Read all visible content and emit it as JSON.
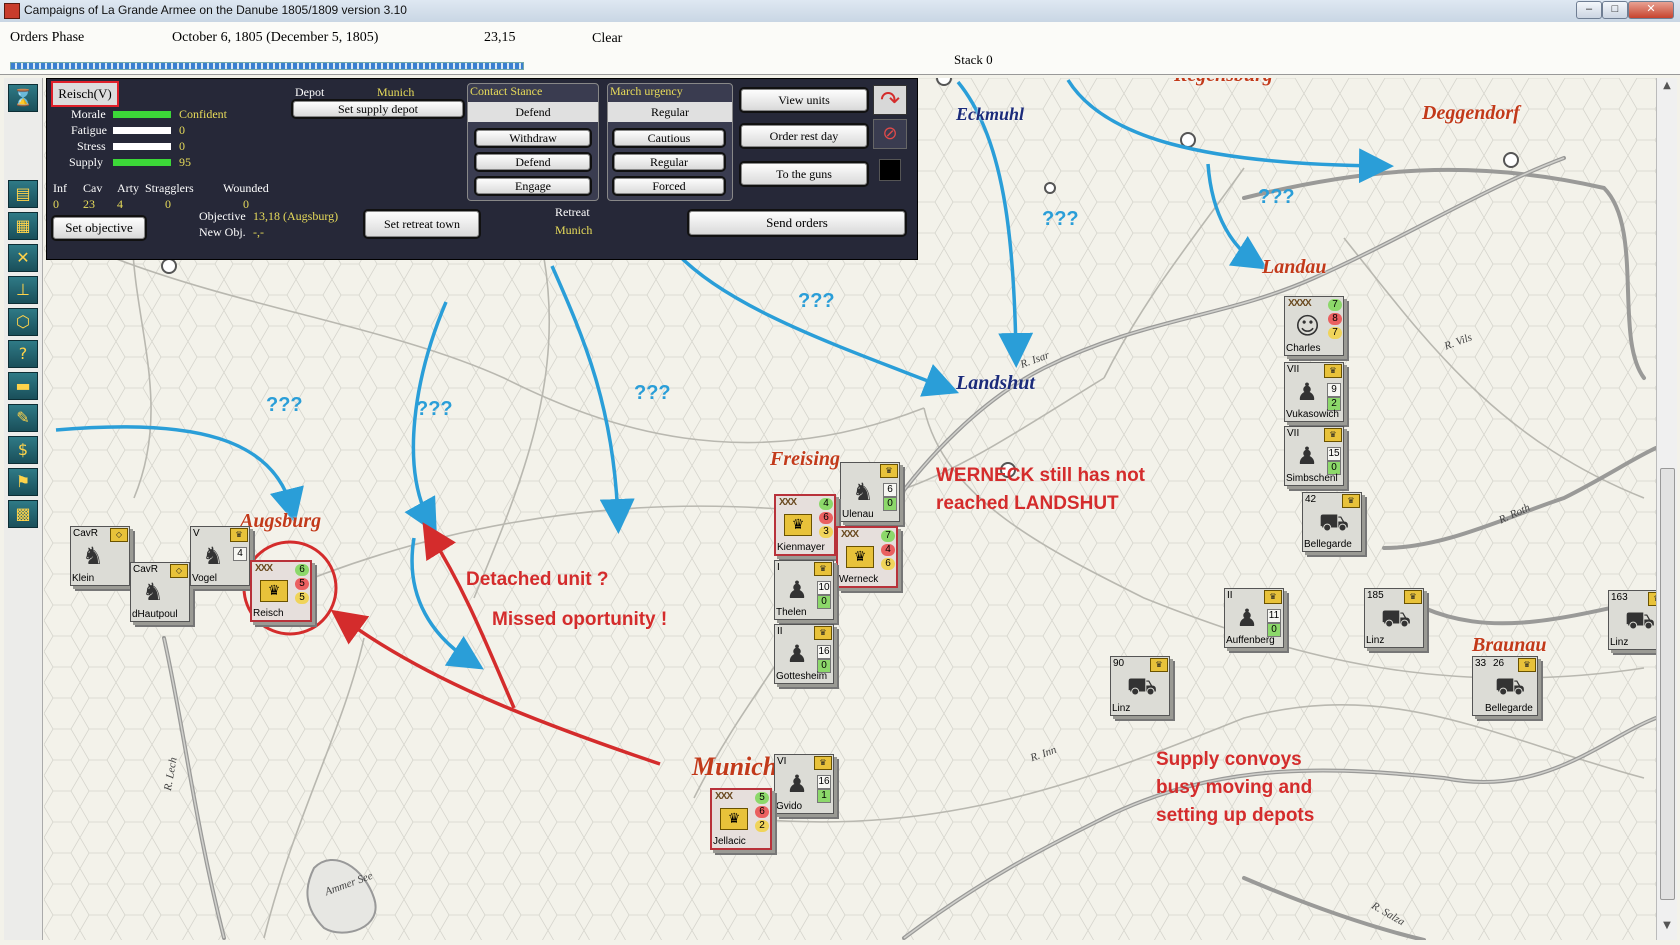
{
  "window": {
    "title": "Campaigns of La Grande Armee on the Danube 1805/1809 version 3.10",
    "min": "–",
    "max": "□",
    "close": "✕"
  },
  "topbar": {
    "phase": "Orders Phase",
    "date": "October 6, 1805 (December 5, 1805)",
    "coords": "23,15",
    "clear": "Clear",
    "stack": "Stack 0"
  },
  "toolbar_icons": [
    "hourglass-icon",
    "scroll-icon",
    "stack-icon",
    "crossed-swords-icon",
    "hierarchy-icon",
    "hexagon-icon",
    "question-icon",
    "ledger-icon",
    "pencil-icon",
    "dollar-icon",
    "flag-icon",
    "grid-icon"
  ],
  "panel": {
    "unit_name": "Reisch(V)",
    "morale_label": "Morale",
    "morale_value": "Confident",
    "fatigue_label": "Fatigue",
    "fatigue_value": "0",
    "stress_label": "Stress",
    "stress_value": "0",
    "supply_label": "Supply",
    "supply_value": "95",
    "inf_label": "Inf",
    "inf_value": "0",
    "cav_label": "Cav",
    "cav_value": "23",
    "arty_label": "Arty",
    "arty_value": "4",
    "stragglers_label": "Stragglers",
    "stragglers_value": "0",
    "wounded_label": "Wounded",
    "wounded_value": "0",
    "set_objective": "Set objective",
    "objective_label": "Objective",
    "objective_value": "13,18 (Augsburg)",
    "newobj_label": "New Obj.",
    "newobj_value": "-,-",
    "depot_label": "Depot",
    "depot_value": "Munich",
    "set_supply_depot": "Set supply depot",
    "set_retreat_town": "Set retreat town",
    "retreat_label": "Retreat",
    "retreat_value": "Munich",
    "contact_stance_label": "Contact Stance",
    "contact_stance_value": "Defend",
    "withdraw": "Withdraw",
    "defend": "Defend",
    "engage": "Engage",
    "march_urgency_label": "March urgency",
    "march_urgency_value": "Regular",
    "cautious": "Cautious",
    "regular": "Regular",
    "forced": "Forced",
    "view_units": "View units",
    "order_rest_day": "Order rest day",
    "to_the_guns": "To the guns",
    "send_orders": "Send orders"
  },
  "cities": {
    "augsburg": "Augsburg",
    "munich": "Munich",
    "freising": "Freising",
    "landshut": "Landshut",
    "landau": "Landau",
    "deggendorf": "Deggendorf",
    "eckmuhl": "Eckmuhl",
    "braunau": "Braunau",
    "regensburg": "Regensburg"
  },
  "rivers": {
    "isar": "R. Isar",
    "vils": "R. Vils",
    "roth": "R. Roth",
    "inn": "R. Inn",
    "lech": "R. Lech",
    "salza": "R. Salza",
    "ammer_see": "Ammer See"
  },
  "annotations": {
    "werneck": [
      "WERNECK still has not",
      "reached LANDSHUT"
    ],
    "detached": "Detached unit ?",
    "missed": "Missed oportunity !",
    "supply": [
      "Supply convoys",
      "busy moving and",
      "setting up depots"
    ],
    "question": "???"
  },
  "counters": [
    {
      "name": "Klein",
      "corps": "CavR"
    },
    {
      "name": "dHautpoul",
      "corps": "CavR"
    },
    {
      "name": "Vogel",
      "corps": "V",
      "a": "4"
    },
    {
      "name": "Reisch",
      "xxx": "XXX",
      "a": "6",
      "b": "5",
      "c": "5"
    },
    {
      "name": "Kienmayer",
      "xxx": "XXX",
      "a": "4",
      "b": "6",
      "c": "3"
    },
    {
      "name": "Werneck",
      "xxx": "XXX",
      "a": "7",
      "b": "4",
      "c": "6"
    },
    {
      "name": "Ulenau",
      "a": "6",
      "b": "0"
    },
    {
      "name": "Thelen",
      "corps": "I",
      "a": "10",
      "b": "0"
    },
    {
      "name": "Gottesheim",
      "corps": "II",
      "a": "16",
      "b": "0"
    },
    {
      "name": "Jellacic",
      "xxx": "XXX",
      "a": "5",
      "b": "6",
      "c": "2"
    },
    {
      "name": "Gvido",
      "corps": "VI",
      "a": "16",
      "b": "1"
    },
    {
      "name": "Charles",
      "xxx": "XXXX",
      "a": "7",
      "b": "8",
      "c": "7"
    },
    {
      "name": "Vukasowich",
      "corps": "VII",
      "a": "9",
      "b": "2"
    },
    {
      "name": "Simbschenl",
      "corps": "VII",
      "a": "15",
      "b": "0"
    },
    {
      "name": "Bellegarde",
      "corps": "42"
    },
    {
      "name": "Auffenberg",
      "corps": "II",
      "a": "11",
      "b": "0"
    },
    {
      "name": "Linz",
      "corps": "185"
    },
    {
      "name": "Linz",
      "corps": "163"
    },
    {
      "name": "Linz",
      "corps": "90"
    },
    {
      "name": "Bellegarde",
      "corps": "26",
      "extra": "33"
    }
  ]
}
